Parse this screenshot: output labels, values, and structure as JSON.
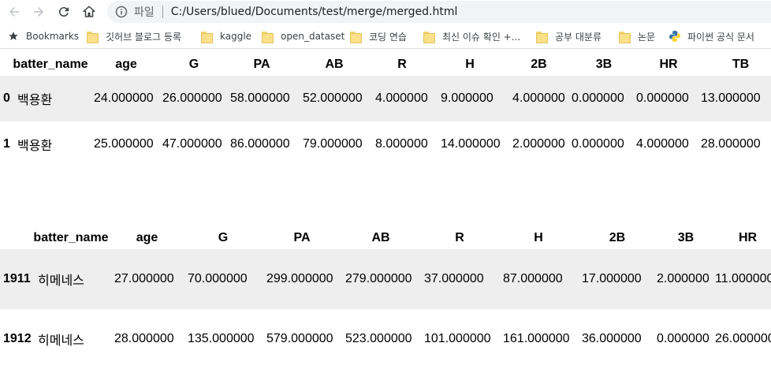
{
  "browser": {
    "scheme_label": "파일",
    "url": "C:/Users/blued/Documents/test/merge/merged.html"
  },
  "bookmarks": [
    {
      "label": "Bookmarks",
      "icon": "star-icon"
    },
    {
      "label": "깃허브 블로그 등록",
      "icon": "folder-icon"
    },
    {
      "label": "kaggle",
      "icon": "folder-icon"
    },
    {
      "label": "open_dataset",
      "icon": "folder-icon"
    },
    {
      "label": "코딩 연습",
      "icon": "folder-icon"
    },
    {
      "label": "최신 이슈 확인 +...",
      "icon": "folder-icon"
    },
    {
      "label": "공부 대분류",
      "icon": "folder-icon"
    },
    {
      "label": "논문",
      "icon": "folder-icon"
    },
    {
      "label": "파이썬 공식 문서",
      "icon": "python-icon"
    }
  ],
  "table1": {
    "headers": [
      "batter_name",
      "age",
      "G",
      "PA",
      "AB",
      "R",
      "H",
      "2B",
      "3B",
      "HR",
      "TB"
    ],
    "rows": [
      {
        "index": "0",
        "cells": [
          "백용환",
          "24.000000",
          "26.000000",
          "58.000000",
          "52.000000",
          "4.000000",
          "9.000000",
          "4.000000",
          "0.000000",
          "0.000000",
          "13.000000"
        ]
      },
      {
        "index": "1",
        "cells": [
          "백용환",
          "25.000000",
          "47.000000",
          "86.000000",
          "79.000000",
          "8.000000",
          "14.000000",
          "2.000000",
          "0.000000",
          "4.000000",
          "28.000000"
        ]
      }
    ]
  },
  "table2": {
    "headers": [
      "batter_name",
      "age",
      "G",
      "PA",
      "AB",
      "R",
      "H",
      "2B",
      "3B",
      "HR"
    ],
    "rows": [
      {
        "index": "1911",
        "cells": [
          "히메네스",
          "27.000000",
          "70.000000",
          "299.000000",
          "279.000000",
          "37.000000",
          "87.000000",
          "17.000000",
          "2.000000",
          "11.000000"
        ]
      },
      {
        "index": "1912",
        "cells": [
          "히메네스",
          "28.000000",
          "135.000000",
          "579.000000",
          "523.000000",
          "101.000000",
          "161.000000",
          "36.000000",
          "0.000000",
          "26.000000"
        ]
      }
    ]
  }
}
